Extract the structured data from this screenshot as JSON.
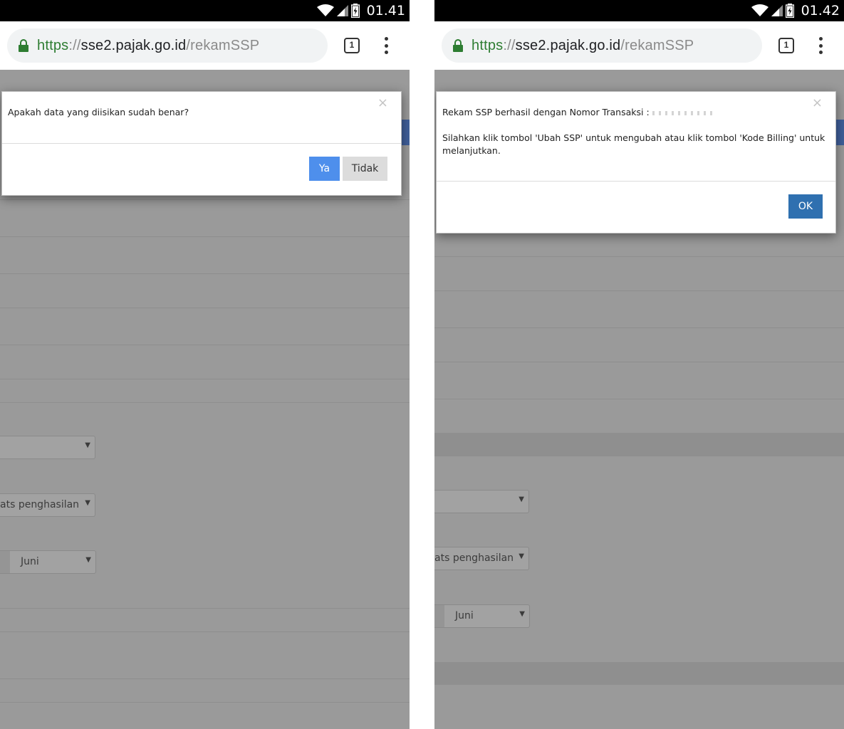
{
  "left": {
    "status_time": "01.41",
    "url": {
      "scheme": "https",
      "sep": "://",
      "host": "sse2.pajak.go.id",
      "path": "/rekamSSP"
    },
    "tab_count": "1",
    "dialog": {
      "close": "×",
      "message": "Apakah data yang diisikan sudah benar?",
      "yes_label": "Ya",
      "no_label": "Tidak"
    },
    "background_fields": {
      "income_select": "ats penghasilan",
      "month_select": "Juni"
    }
  },
  "right": {
    "status_time": "01.42",
    "url": {
      "scheme": "https",
      "sep": "://",
      "host": "sse2.pajak.go.id",
      "path": "/rekamSSP"
    },
    "tab_count": "1",
    "dialog": {
      "close": "×",
      "message_line1": "Rekam SSP berhasil dengan Nomor Transaksi :",
      "message_line2": "Silahkan klik tombol 'Ubah SSP' untuk mengubah atau klik tombol 'Kode Billing' untuk melanjutkan.",
      "ok_label": "OK"
    },
    "background_fields": {
      "income_select": "ats penghasilan",
      "month_select": "Juni"
    }
  },
  "colors": {
    "ya_button": "#4e8fec",
    "ok_button": "#2f70b0",
    "overlay": "#9a9a9a",
    "secure_green": "#2e7d32"
  },
  "icons": [
    "wifi-icon",
    "signal-icon",
    "battery-icon",
    "lock-icon",
    "tab-switcher-icon",
    "overflow-menu-icon",
    "close-icon",
    "dropdown-caret-icon"
  ]
}
